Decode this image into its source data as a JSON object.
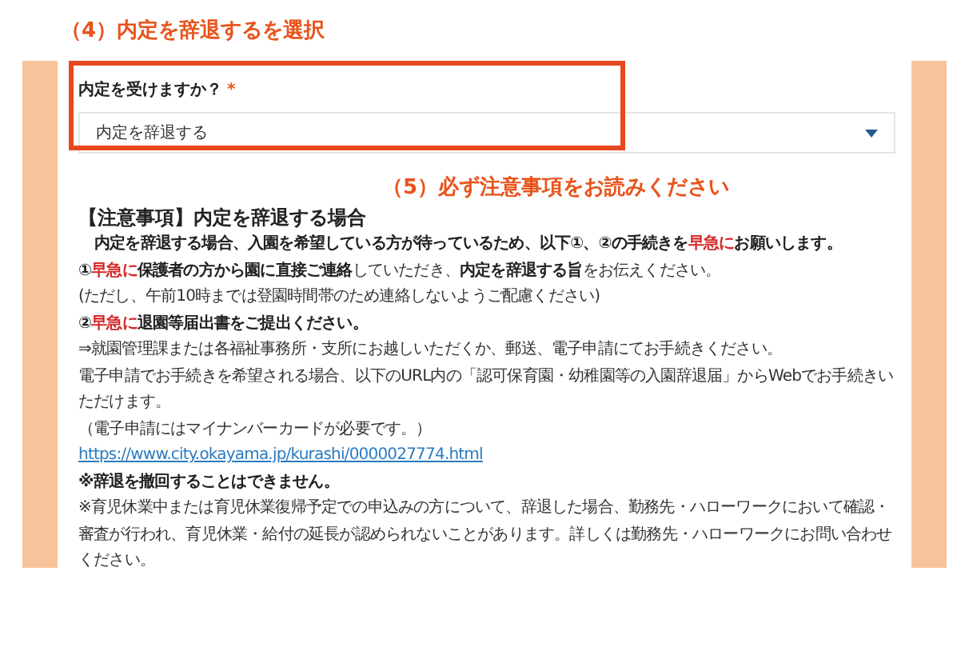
{
  "step_4_caption": "（4）内定を辞退するを選択",
  "question": {
    "label": "内定を受けますか？",
    "required_mark": "*",
    "value": "内定を辞退する"
  },
  "step_5_caption": "（5）必ず注意事項をお読みください",
  "notice": {
    "heading": "【注意事項】内定を辞退する場合",
    "paragraphs": [
      {
        "indent": true,
        "runs": [
          {
            "text": "内定を辞退する場合、入園を希望している方が待っているため、以下①、②の手続きを",
            "kind": "bold"
          },
          {
            "text": "早急に",
            "kind": "urgent"
          },
          {
            "text": "お願いします。",
            "kind": "bold"
          }
        ]
      },
      {
        "indent": false,
        "runs": [
          {
            "text": "①",
            "kind": "bold"
          },
          {
            "text": "早急に",
            "kind": "urgent"
          },
          {
            "text": "保護者の方から園に直接ご連絡",
            "kind": "bold"
          },
          {
            "text": "していただき、",
            "kind": "plain"
          },
          {
            "text": "内定を辞退する旨",
            "kind": "bold"
          },
          {
            "text": "をお伝えください。",
            "kind": "plain"
          }
        ]
      },
      {
        "indent": false,
        "runs": [
          {
            "text": "(ただし、午前10時までは登園時間帯のため連絡しないようご配慮ください)",
            "kind": "plain"
          }
        ]
      },
      {
        "indent": false,
        "runs": [
          {
            "text": "②",
            "kind": "bold"
          },
          {
            "text": "早急に",
            "kind": "urgent"
          },
          {
            "text": "退園等届出書をご提出ください。",
            "kind": "bold"
          }
        ]
      },
      {
        "indent": false,
        "runs": [
          {
            "text": "⇒就園管理課または各福祉事務所・支所にお越しいただくか、郵送、電子申請にてお手続きください。",
            "kind": "plain"
          }
        ]
      },
      {
        "indent": false,
        "runs": [
          {
            "text": "電子申請でお手続きを希望される場合、以下のURL内の「認可保育園・幼稚園等の入園辞退届」からWebでお手続きいただけます。",
            "kind": "plain"
          }
        ]
      },
      {
        "indent": false,
        "runs": [
          {
            "text": "（電子申請にはマイナンバーカードが必要です。）",
            "kind": "plain"
          }
        ]
      },
      {
        "indent": false,
        "runs": [
          {
            "text": "https://www.city.okayama.jp/kurashi/0000027774.html",
            "kind": "link"
          }
        ]
      },
      {
        "indent": false,
        "runs": [
          {
            "text": "※辞退を撤回することはできません。",
            "kind": "bold"
          }
        ]
      },
      {
        "indent": false,
        "runs": [
          {
            "text": "※育児休業中または育児休業復帰予定での申込みの方について、辞退した場合、勤務先・ハローワークにおいて確認・審査が行われ、育児休業・給付の延長が認められないことがあります。詳しくは勤務先・ハローワークにお問い合わせください。",
            "kind": "plain"
          }
        ]
      }
    ]
  }
}
